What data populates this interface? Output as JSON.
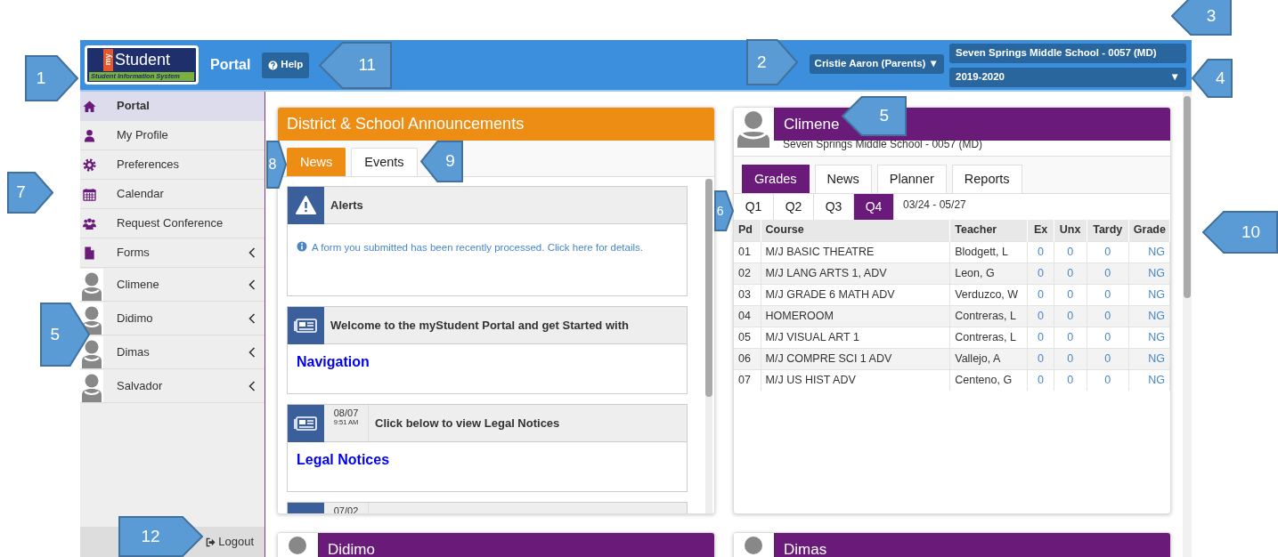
{
  "header": {
    "logo": {
      "prefix": "my",
      "brand": "Student",
      "tagline": "Student Information System"
    },
    "title": "Portal",
    "help_button": "Help",
    "user_menu": "Cristie Aaron (Parents) ▼",
    "school": "Seven Springs Middle School - 0057 (MD)",
    "year": "2019-2020",
    "year_caret": "▼"
  },
  "sidebar": {
    "items": [
      {
        "label": "Portal",
        "kind": "home",
        "selected": true,
        "expandable": false
      },
      {
        "label": "My Profile",
        "kind": "user",
        "selected": false,
        "expandable": false
      },
      {
        "label": "Preferences",
        "kind": "gear",
        "selected": false,
        "expandable": false
      },
      {
        "label": "Calendar",
        "kind": "calendar",
        "selected": false,
        "expandable": false
      },
      {
        "label": "Request Conference",
        "kind": "group",
        "selected": false,
        "expandable": false
      },
      {
        "label": "Forms",
        "kind": "document",
        "selected": false,
        "expandable": true
      },
      {
        "label": "Climene",
        "kind": "student",
        "selected": false,
        "expandable": true
      },
      {
        "label": "Didimo",
        "kind": "student",
        "selected": false,
        "expandable": true
      },
      {
        "label": "Dimas",
        "kind": "student",
        "selected": false,
        "expandable": true
      },
      {
        "label": "Salvador",
        "kind": "student",
        "selected": false,
        "expandable": true
      }
    ],
    "logout": "Logout"
  },
  "announcements": {
    "title": "District & School Announcements",
    "tabs": [
      {
        "label": "News",
        "selected": true
      },
      {
        "label": "Events",
        "selected": false
      }
    ],
    "items": [
      {
        "kind": "alert",
        "title": "Alerts",
        "body": "A form you submitted has been recently processed. Click here for details."
      },
      {
        "kind": "news",
        "title": "Welcome to the myStudent Portal and get Started with",
        "link": "Navigation"
      },
      {
        "kind": "news",
        "date": "08/07",
        "time": "9:51 AM",
        "title": "Click below to view Legal Notices",
        "link": "Legal Notices"
      },
      {
        "kind": "news",
        "date": "07/02"
      }
    ]
  },
  "students": [
    {
      "name": "Climene",
      "school": "Seven Springs Middle School - 0057 (MD)",
      "tabs": [
        {
          "label": "Grades",
          "selected": true
        },
        {
          "label": "News",
          "selected": false
        },
        {
          "label": "Planner",
          "selected": false
        },
        {
          "label": "Reports",
          "selected": false
        }
      ],
      "quarters": [
        {
          "label": "Q1",
          "selected": false
        },
        {
          "label": "Q2",
          "selected": false
        },
        {
          "label": "Q3",
          "selected": false
        },
        {
          "label": "Q4",
          "selected": true
        }
      ],
      "date_range": "03/24 - 05/27",
      "table": {
        "columns": [
          "Pd",
          "Course",
          "Teacher",
          "Ex",
          "Unx",
          "Tardy",
          "Grade"
        ],
        "rows": [
          [
            "01",
            "M/J BASIC THEATRE",
            "Blodgett, L",
            "0",
            "0",
            "0",
            "NG"
          ],
          [
            "02",
            "M/J LANG ARTS 1, ADV",
            "Leon, G",
            "0",
            "0",
            "0",
            "NG"
          ],
          [
            "03",
            "M/J GRADE 6 MATH ADV",
            "Verduzco, W",
            "0",
            "0",
            "0",
            "NG"
          ],
          [
            "04",
            "HOMEROOM",
            "Contreras, L",
            "0",
            "0",
            "0",
            "NG"
          ],
          [
            "05",
            "M/J VISUAL ART 1",
            "Contreras, L",
            "0",
            "0",
            "0",
            "NG"
          ],
          [
            "06",
            "M/J COMPRE SCI 1 ADV",
            "Vallejo, A",
            "0",
            "0",
            "0",
            "NG"
          ],
          [
            "07",
            "M/J US HIST ADV",
            "Centeno, G",
            "0",
            "0",
            "0",
            "NG"
          ]
        ]
      }
    },
    {
      "name": "Didimo"
    },
    {
      "name": "Dimas"
    }
  ],
  "callouts": [
    {
      "number": "1"
    },
    {
      "number": "2"
    },
    {
      "number": "3"
    },
    {
      "number": "4"
    },
    {
      "number": "5"
    },
    {
      "number": "5"
    },
    {
      "number": "6"
    },
    {
      "number": "7"
    },
    {
      "number": "8"
    },
    {
      "number": "9"
    },
    {
      "number": "10"
    },
    {
      "number": "11"
    },
    {
      "number": "12"
    }
  ]
}
